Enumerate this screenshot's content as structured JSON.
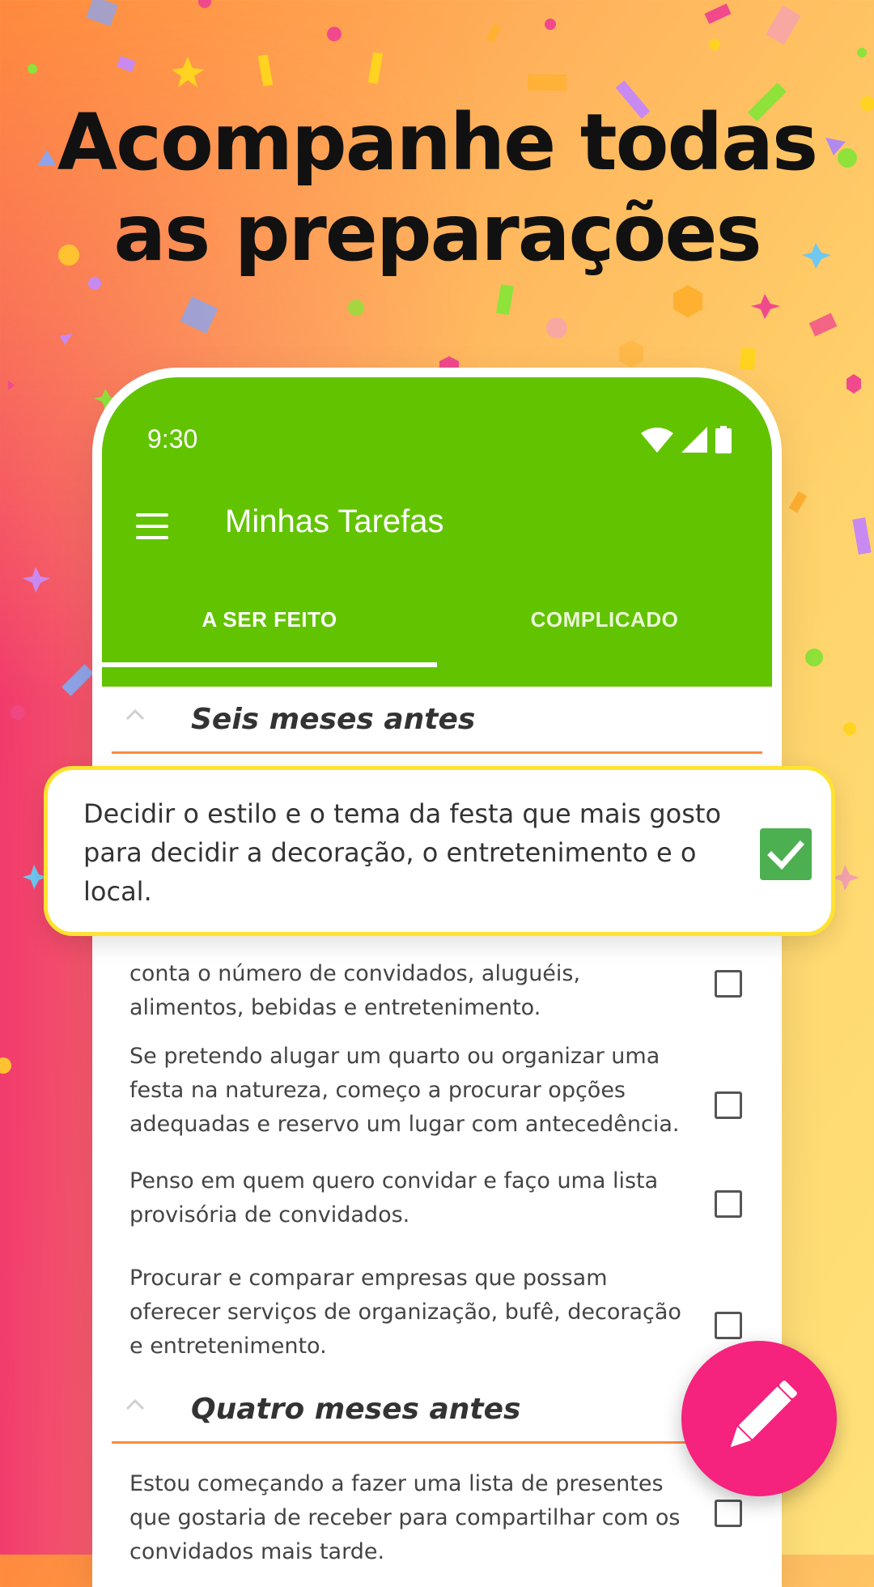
{
  "headline": {
    "line1": "Acompanhe todas",
    "line2": "as preparações"
  },
  "status_bar": {
    "time": "9:30"
  },
  "app_bar": {
    "title": "Minhas Tarefas"
  },
  "tabs": [
    {
      "label": "A SER FEITO",
      "active": true
    },
    {
      "label": "COMPLICADO",
      "active": false
    }
  ],
  "sections": [
    {
      "title": "Seis meses antes"
    },
    {
      "title": "Quatro meses antes"
    }
  ],
  "highlighted_task": {
    "text": "Decidir o estilo e o tema da festa que mais gosto para decidir a decoração, o entretenimento e o local.",
    "checked": true
  },
  "tasks": [
    {
      "text": "conta o número de convidados, aluguéis, alimentos, bebidas e entretenimento.",
      "checked": false
    },
    {
      "text": "Se pretendo alugar um quarto ou organizar uma festa na natureza, começo a procurar opções adequadas e reservo um lugar com antecedência.",
      "checked": false
    },
    {
      "text": "Penso em quem quero convidar e faço uma lista provisória de convidados.",
      "checked": false
    },
    {
      "text": "Procurar e comparar empresas que possam oferecer serviços de organização, bufê, decoração e entretenimento.",
      "checked": false
    },
    {
      "text": "Estou começando a fazer uma lista de presentes que gostaria de receber para compartilhar com os convidados mais tarde.",
      "checked": false
    }
  ],
  "icons": {
    "menu": "menu-icon",
    "wifi": "wifi-icon",
    "signal": "signal-icon",
    "battery": "battery-icon",
    "collapse": "chevron-up-icon",
    "check": "check-icon",
    "fab": "pencil-icon"
  },
  "colors": {
    "app_bar": "#62c300",
    "section_divider": "#ff8a3d",
    "highlight_border": "#ffe232",
    "check_green": "#4caf50",
    "fab": "#f5227e"
  }
}
